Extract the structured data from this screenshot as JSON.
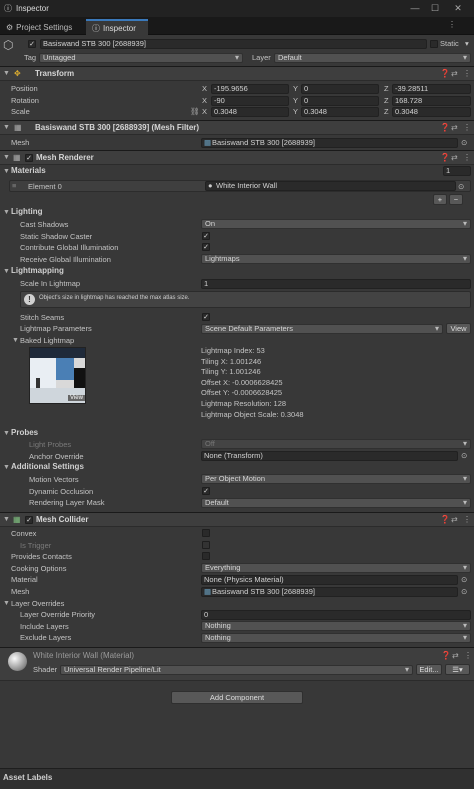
{
  "window": {
    "title": "Inspector"
  },
  "tabs": [
    {
      "label": "Project Settings"
    },
    {
      "label": "Inspector"
    }
  ],
  "object": {
    "name": "Basiswand STB 300 [2688939]",
    "static_label": "Static",
    "tag_label": "Tag",
    "tag_value": "Untagged",
    "layer_label": "Layer",
    "layer_value": "Default"
  },
  "transform": {
    "title": "Transform",
    "position_label": "Position",
    "rotation_label": "Rotation",
    "scale_label": "Scale",
    "position": {
      "x": "-195.9656",
      "y": "0",
      "z": "-39.28511"
    },
    "rotation": {
      "x": "-90",
      "y": "0",
      "z": "168.728"
    },
    "scale": {
      "x": "0.3048",
      "y": "0.3048",
      "z": "0.3048"
    },
    "axis_x": "X",
    "axis_y": "Y",
    "axis_z": "Z"
  },
  "mesh_filter": {
    "title": "Basiswand STB 300 [2688939] (Mesh Filter)",
    "mesh_label": "Mesh",
    "mesh_value": "Basiswand STB 300 [2688939]"
  },
  "mesh_renderer": {
    "title": "Mesh Renderer",
    "materials_label": "Materials",
    "materials_count": "1",
    "element_label": "Element 0",
    "element_value": "White Interior Wall",
    "lighting_label": "Lighting",
    "cast_shadows_label": "Cast Shadows",
    "cast_shadows_value": "On",
    "static_caster_label": "Static Shadow Caster",
    "contribute_gi_label": "Contribute Global Illumination",
    "receive_gi_label": "Receive Global Illumination",
    "receive_gi_value": "Lightmaps",
    "lightmapping_label": "Lightmapping",
    "scale_lightmap_label": "Scale In Lightmap",
    "scale_lightmap_value": "1",
    "warning_text": "Object's size in lightmap has reached the max atlas size.",
    "stitch_label": "Stitch Seams",
    "lm_params_label": "Lightmap Parameters",
    "lm_params_value": "Scene Default Parameters",
    "view_label": "View",
    "baked_label": "Baked Lightmap",
    "thumb_view": "View",
    "lm_info": [
      "Lightmap Index: 53",
      "Tiling X: 1.001246",
      "Tiling Y: 1.001246",
      "Offset X: -0.0006628425",
      "Offset Y: -0.0006628425",
      "Lightmap Resolution: 128",
      "Lightmap Object Scale: 0.3048"
    ],
    "probes_label": "Probes",
    "light_probes_label": "Light Probes",
    "light_probes_value": "Off",
    "anchor_label": "Anchor Override",
    "anchor_value": "None (Transform)",
    "additional_label": "Additional Settings",
    "motion_label": "Motion Vectors",
    "motion_value": "Per Object Motion",
    "dyn_occ_label": "Dynamic Occlusion",
    "rlm_label": "Rendering Layer Mask",
    "rlm_value": "Default"
  },
  "mesh_collider": {
    "title": "Mesh Collider",
    "convex_label": "Convex",
    "trigger_label": "Is Trigger",
    "contacts_label": "Provides Contacts",
    "cooking_label": "Cooking Options",
    "cooking_value": "Everything",
    "material_label": "Material",
    "material_value": "None (Physics Material)",
    "mesh_label": "Mesh",
    "mesh_value": "Basiswand STB 300 [2688939]",
    "overrides_label": "Layer Overrides",
    "priority_label": "Layer Override Priority",
    "priority_value": "0",
    "include_label": "Include Layers",
    "include_value": "Nothing",
    "exclude_label": "Exclude Layers",
    "exclude_value": "Nothing"
  },
  "material": {
    "title": "White Interior Wall (Material)",
    "shader_label": "Shader",
    "shader_value": "Universal Render Pipeline/Lit",
    "edit_label": "Edit..."
  },
  "add_component": "Add Component",
  "asset_labels": "Asset Labels",
  "colors": {
    "accent": "#3a79bb",
    "background": "#383838"
  }
}
